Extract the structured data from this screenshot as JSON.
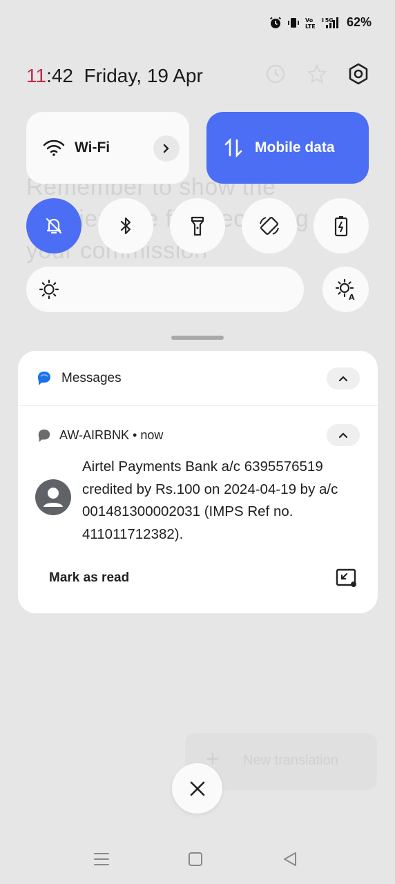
{
  "status_bar": {
    "battery": "62%",
    "icons": [
      "alarm-icon",
      "vibrate-icon",
      "volte-icon",
      "5g-signal-icon"
    ]
  },
  "header": {
    "time_hour": "11",
    "time_rest": ":42",
    "date": "Friday, 19 Apr",
    "icons": [
      "history-icon",
      "star-icon",
      "settings-icon"
    ]
  },
  "background_app": {
    "ghost_text": "Remember to show the recipient the first receiving your commission",
    "ghost_button": "New translation"
  },
  "quick_settings": {
    "wifi_label": "Wi-Fi",
    "mobile_data_label": "Mobile data",
    "toggles": [
      "do-not-disturb",
      "bluetooth",
      "flashlight",
      "auto-rotate",
      "battery-saver"
    ],
    "accent": "#4c6ef5"
  },
  "notification": {
    "app_name": "Messages",
    "sender": "AW-AIRBNK",
    "time": "now",
    "message": "Airtel Payments Bank a/c 6395576519 credited by Rs.100 on 2024-04-19 by a/c 001481300002031 (IMPS Ref no. 411011712382).",
    "action": "Mark as read"
  }
}
